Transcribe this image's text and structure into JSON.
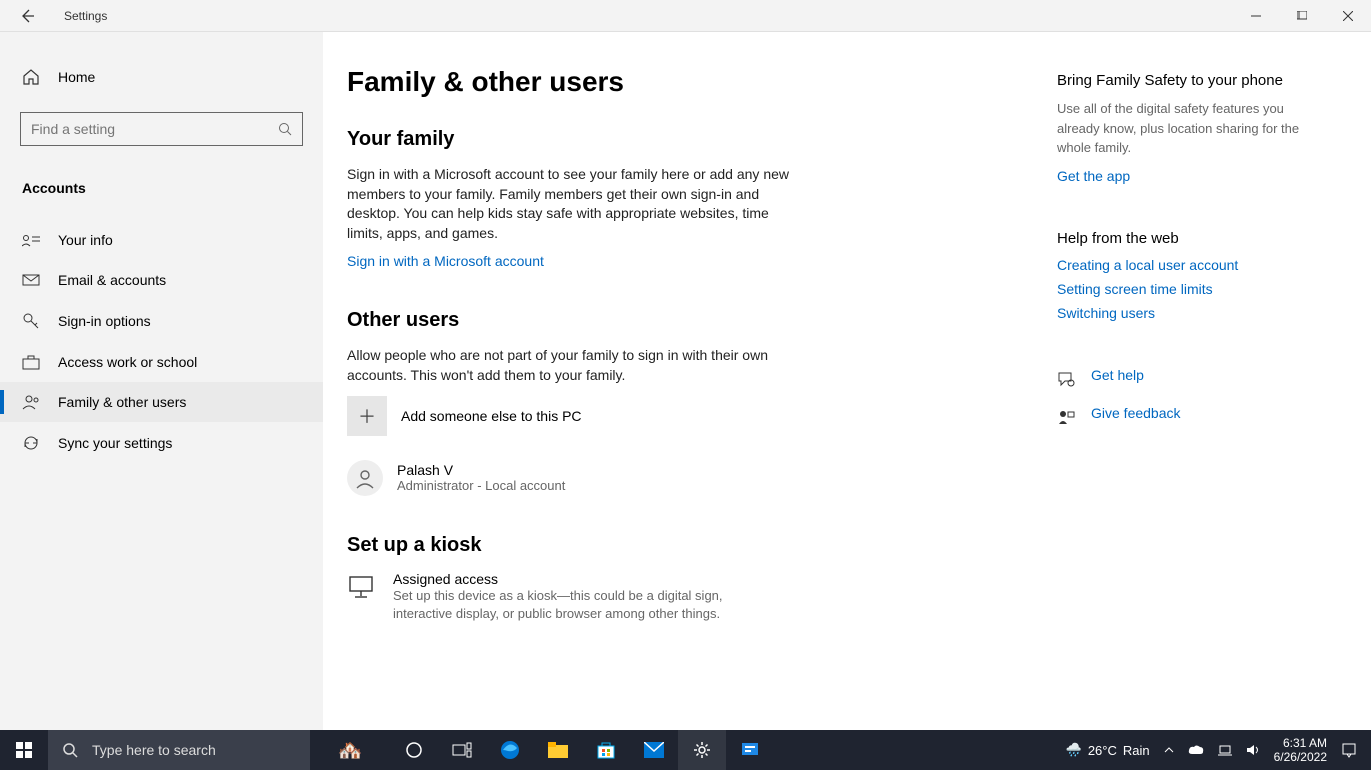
{
  "titlebar": {
    "title": "Settings"
  },
  "sidebar": {
    "home_label": "Home",
    "search_placeholder": "Find a setting",
    "category": "Accounts",
    "items": [
      {
        "label": "Your info"
      },
      {
        "label": "Email & accounts"
      },
      {
        "label": "Sign-in options"
      },
      {
        "label": "Access work or school"
      },
      {
        "label": "Family & other users"
      },
      {
        "label": "Sync your settings"
      }
    ]
  },
  "main": {
    "title": "Family & other users",
    "family": {
      "heading": "Your family",
      "body": "Sign in with a Microsoft account to see your family here or add any new members to your family. Family members get their own sign-in and desktop. You can help kids stay safe with appropriate websites, time limits, apps, and games.",
      "link": "Sign in with a Microsoft account"
    },
    "other": {
      "heading": "Other users",
      "body": "Allow people who are not part of your family to sign in with their own accounts. This won't add them to your family.",
      "add_label": "Add someone else to this PC",
      "user": {
        "name": "Palash V",
        "role": "Administrator - Local account"
      }
    },
    "kiosk": {
      "heading": "Set up a kiosk",
      "title": "Assigned access",
      "desc": "Set up this device as a kiosk—this could be a digital sign, interactive display, or public browser among other things."
    }
  },
  "rail": {
    "safety": {
      "title": "Bring Family Safety to your phone",
      "desc": "Use all of the digital safety features you already know, plus location sharing for the whole family.",
      "link": "Get the app"
    },
    "help": {
      "title": "Help from the web",
      "links": [
        "Creating a local user account",
        "Setting screen time limits",
        "Switching users"
      ]
    },
    "get_help": "Get help",
    "feedback": "Give feedback"
  },
  "taskbar": {
    "search_placeholder": "Type here to search",
    "weather_temp": "26°C",
    "weather_cond": "Rain",
    "time": "6:31 AM",
    "date": "6/26/2022"
  }
}
